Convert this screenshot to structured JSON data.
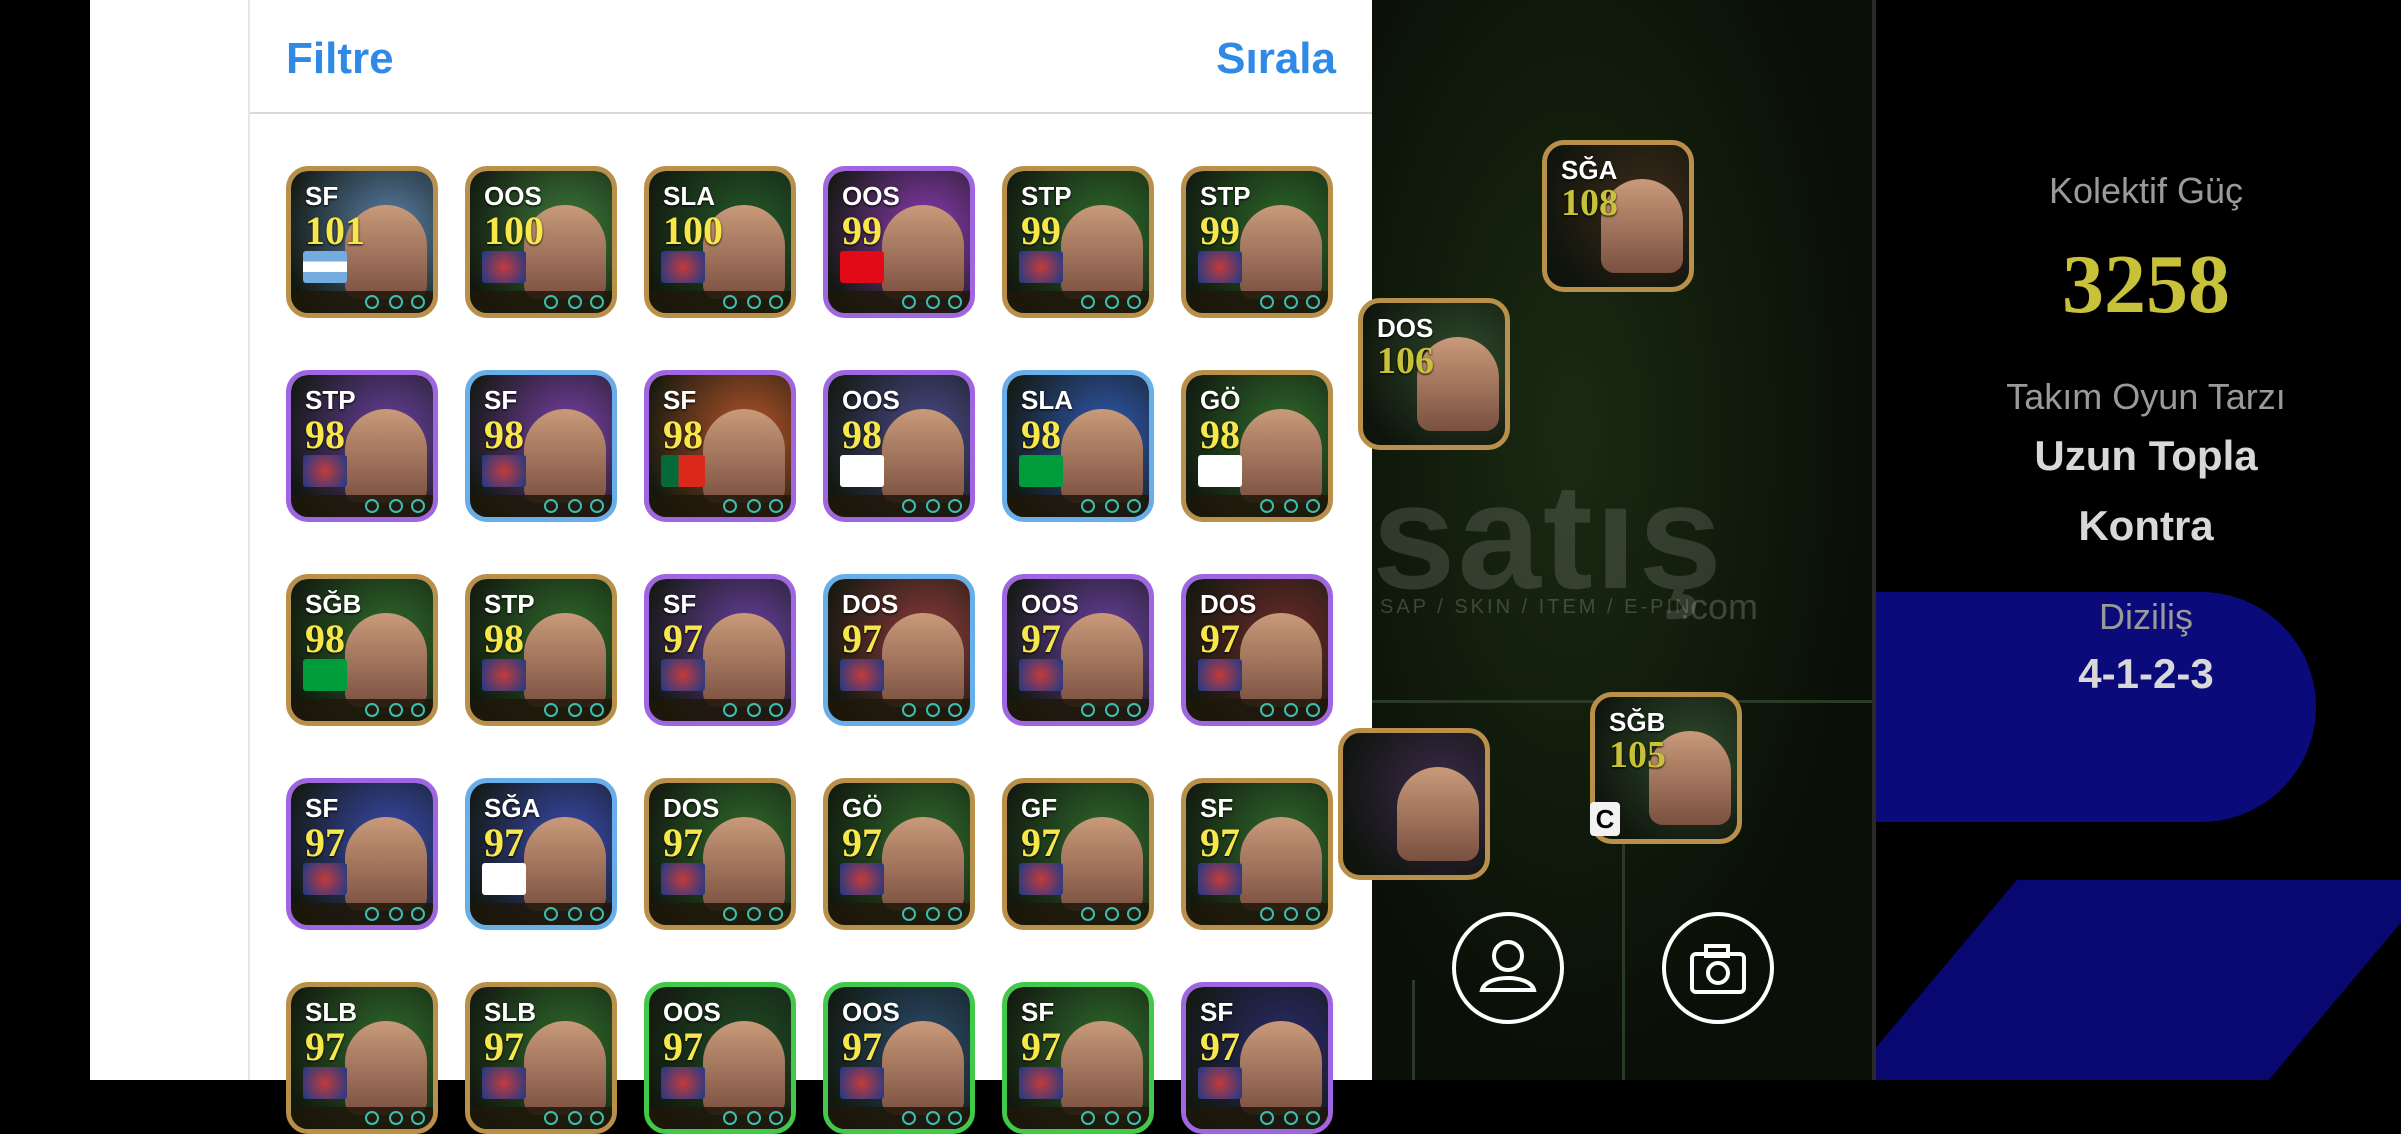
{
  "header": {
    "filter_label": "Filtre",
    "sort_label": "Sırala"
  },
  "players": [
    {
      "pos": "SF",
      "rating": "101",
      "border": "gold",
      "bg": "#5a7fa8",
      "flag": "argentina-flag"
    },
    {
      "pos": "OOS",
      "rating": "100",
      "border": "gold",
      "bg": "#3d7a3a",
      "flag": "club-badge"
    },
    {
      "pos": "SLA",
      "rating": "100",
      "border": "gold",
      "bg": "#245a2a",
      "flag": "barcelona-badge"
    },
    {
      "pos": "OOS",
      "rating": "99",
      "border": "purple",
      "bg": "#8a3ab0",
      "flag": "turkey-flag"
    },
    {
      "pos": "STP",
      "rating": "99",
      "border": "gold",
      "bg": "#2f6a2c",
      "flag": "bayern-badge"
    },
    {
      "pos": "STP",
      "rating": "99",
      "border": "gold",
      "bg": "#2c6a2a",
      "flag": "milan-badge"
    },
    {
      "pos": "STP",
      "rating": "98",
      "border": "purple",
      "bg": "#6a3fa0",
      "flag": "fluminense-badge"
    },
    {
      "pos": "SF",
      "rating": "98",
      "border": "blue",
      "bg": "#7a3fa8",
      "flag": "galatasaray-badge"
    },
    {
      "pos": "SF",
      "rating": "98",
      "border": "purple",
      "bg": "#b4542a",
      "flag": "portugal-flag"
    },
    {
      "pos": "OOS",
      "rating": "98",
      "border": "purple",
      "bg": "#4a4a8a",
      "flag": "england-flag"
    },
    {
      "pos": "SLA",
      "rating": "98",
      "border": "blue",
      "bg": "#3058b0",
      "flag": "brazil-flag"
    },
    {
      "pos": "GÖ",
      "rating": "98",
      "border": "gold",
      "bg": "#2f6a2c",
      "flag": "england-flag"
    },
    {
      "pos": "SĞB",
      "rating": "98",
      "border": "gold",
      "bg": "#2f6a2c",
      "flag": "brazil-flag"
    },
    {
      "pos": "STP",
      "rating": "98",
      "border": "gold",
      "bg": "#2f6a2c",
      "flag": "bayern-badge"
    },
    {
      "pos": "SF",
      "rating": "97",
      "border": "purple",
      "bg": "#6a3fa0",
      "flag": "fenerbahce-badge"
    },
    {
      "pos": "DOS",
      "rating": "97",
      "border": "blue",
      "bg": "#8a3a3a",
      "flag": "arsenal-badge"
    },
    {
      "pos": "OOS",
      "rating": "97",
      "border": "purple",
      "bg": "#6a3fa0",
      "flag": "arsenal-badge"
    },
    {
      "pos": "DOS",
      "rating": "97",
      "border": "purple",
      "bg": "#6a2a2a",
      "flag": "real-madrid-badge"
    },
    {
      "pos": "SF",
      "rating": "97",
      "border": "purple",
      "bg": "#3a4ab0",
      "flag": "real-madrid-badge"
    },
    {
      "pos": "SĞA",
      "rating": "97",
      "border": "blue",
      "bg": "#3a4ab0",
      "flag": "england-flag"
    },
    {
      "pos": "DOS",
      "rating": "97",
      "border": "gold",
      "bg": "#2f6a2c",
      "flag": "barcelona-badge"
    },
    {
      "pos": "GÖ",
      "rating": "97",
      "border": "gold",
      "bg": "#2f6a2c",
      "flag": "la-galaxy-badge"
    },
    {
      "pos": "GF",
      "rating": "97",
      "border": "gold",
      "bg": "#2f6a2c",
      "flag": "barcelona-badge"
    },
    {
      "pos": "SF",
      "rating": "97",
      "border": "gold",
      "bg": "#2f6a2c",
      "flag": "santos-badge"
    },
    {
      "pos": "SLB",
      "rating": "97",
      "border": "gold",
      "bg": "#2f6a2c",
      "flag": "club-badge"
    },
    {
      "pos": "SLB",
      "rating": "97",
      "border": "gold",
      "bg": "#2f6a2c",
      "flag": "club-badge"
    },
    {
      "pos": "OOS",
      "rating": "97",
      "border": "green",
      "bg": "#1f4a24",
      "flag": "club-badge"
    },
    {
      "pos": "OOS",
      "rating": "97",
      "border": "green",
      "bg": "#2a4a6a",
      "flag": "club-badge"
    },
    {
      "pos": "SF",
      "rating": "97",
      "border": "green",
      "bg": "#2f6a2c",
      "flag": "club-badge"
    },
    {
      "pos": "SF",
      "rating": "97",
      "border": "purple",
      "bg": "#2a2a6a",
      "flag": "club-badge"
    }
  ],
  "pitch_players": [
    {
      "pos": "SĞA",
      "rating": "108",
      "bg": "#3a2a1a",
      "flag": "barcelona-badge"
    },
    {
      "pos": "DOS",
      "rating": "106",
      "bg": "#2f4a2c",
      "flag": "czech-flag"
    },
    {
      "pos": "SĞB",
      "rating": "105",
      "bg": "#2f4a2c",
      "flag": "france-flag"
    },
    {
      "pos": "",
      "rating": "",
      "bg": "#3a2a4a",
      "flag": "barcelona-badge"
    }
  ],
  "pitch": {
    "captain_badge": "C",
    "profile_icon": "profile-icon",
    "camera_icon": "camera-icon"
  },
  "watermark": {
    "main": "satış",
    "sub": "SAP / SKIN / ITEM / E-PIN",
    "com": ".com"
  },
  "stats": {
    "power_label": "Kolektif Güç",
    "power_value": "3258",
    "style_label": "Takım Oyun Tarzı",
    "style_value_1": "Uzun Topla",
    "style_value_2": "Kontra",
    "formation_label": "Diziliş",
    "formation_value": "4-1-2-3"
  },
  "colors": {
    "accent": "#2e8ae6",
    "rating": "#f7e74a",
    "power": "#c8c23a"
  }
}
